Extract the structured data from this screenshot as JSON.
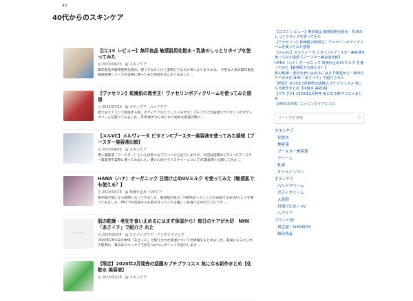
{
  "breadcrumb": "40",
  "page_title": "40代からのスキンケア",
  "posts": [
    {
      "title": "【口コミ レビュー】無印良品 敏感肌用化粧水・乳液のしっとりタイプを使ってみた",
      "date": "2020/09/25",
      "category": "スキンケア",
      "excerpt": "無印良品の敏感肌用化粧水、使ってみたいけど実際どうなのか気になりますよね。 今回は人気の無印良品 敏感肌用シリーズを実際に使ってみた感想をまとめてみました ...",
      "thumb_colors": [
        "#c9b7a3",
        "#e8e0d6",
        "#5b8fc9"
      ]
    },
    {
      "title": "【ヴァセリン】乾燥肌の救世主！ヴァセリンボディクリームを使ってみた感想",
      "date": "2020/07/20",
      "category": "ボディケア・ハンドケア",
      "excerpt": "夏でもエアコンで乾燥する肌、ボディケアはどうしていますか？プチプラで大容量なヴァセリンのボディクリームを使ってみました。30代後半から気になり始めた乾燥対策に ...",
      "thumb_colors": [
        "#b73a3a",
        "#e9d3c4",
        "#8a2424"
      ]
    },
    {
      "title": "【メルVC】メルヴィータ ビタミンCブースター美容液を使ってみた感想【ブースター美容液比較】",
      "date": "2020/04/09",
      "category": "スキンケア",
      "excerpt": "導入美容液（ブースター）といえば色々なブランドから出ていますが、今回は話題のビタミンCブースター美容液を実際に使ってみました。使い心地やテクスチャーについてVC美容液と比較してみた ...",
      "thumb_colors": [
        "#dde3ea",
        "#b7c3d2",
        "#f4f6f8"
      ]
    },
    {
      "title": "HANA（ハナ）オーガニック 日焼け止めUVミルク を使ってみた【敏感肌でも使える？】",
      "date": "2020/03/19",
      "category": "日焼け止め・UVケア",
      "excerpt": "紫外線が気になる季節になってきました。敏感肌の私が、HANAオーガニックの日焼け止めUVミルクを使ってみました。PM2.5や花粉からも肌を守ってくれる優しい日焼け止めの口コミです ...",
      "thumb_colors": [
        "#c9aebf",
        "#8d6e86",
        "#eadde4"
      ]
    },
    {
      "title": "肌の乾燥・老化を食い止めるにはまず保湿から！毎日のケアが大切　NHK「あさイチ」で紹介さ れた",
      "date": "2020/02/04",
      "category": "エイジングケア・アンチエイジング",
      "excerpt": "2020年2月4日のNHK「あさイチ」で紹介された保湿についての情報をまとめました。乾燥による小じわや肌荒れ、毎日のスキンケアで気をつけたいポイントを紹介します ...",
      "thumb_colors": [
        "#f2f2f2",
        "#f2f2f2",
        "#f2f2f2"
      ],
      "noimage_label": "NO IMAGE"
    },
    {
      "title": "【限定】2020年2月発売の話題のプチプラコスメ 気になる新作まとめ【化粧水 美容液】",
      "date": "2020/01/28",
      "category": "スキンケア",
      "excerpt": "",
      "thumb_colors": [
        "#4caf50",
        "#ffffff",
        "#e0e0e0"
      ]
    }
  ],
  "sidebar": {
    "recent_posts": [
      "【口コミ レビュー】無印良品 敏感肌用化粧水・乳液のしっとりタイプを使ってみた",
      "【ヴァセリン】乾燥肌の救世主！ヴァセリンボディクリームを使ってみた感想",
      "【メルVC】メルヴィータ ビタミンCブースター美容液を使ってみた感想【ブースター美容液比較】",
      "HANA（ハナ）オーガニック 日焼け止めUVミルク を使ってみた【敏感肌でも使える？】",
      "肌の乾燥・老化を食い止めるにはまず保湿から！毎日のケアが大切 NHK「あさイチ」で紹介された",
      "【限定】2020年2月発売の話題のプチプラコスメ 気になる新作まとめ【化粧水 美容液】",
      "【プチプラ】2020年2月発売 気になる新作コスメまとめ",
      "【MATURITE】エイジングケア口コミ"
    ],
    "search_placeholder": "サイト内を検索",
    "categories": [
      {
        "label": "スキンケア",
        "level": 0
      },
      {
        "label": "化粧水",
        "level": 1
      },
      {
        "label": "美容液",
        "level": 1
      },
      {
        "label": "ブースター美容液",
        "level": 1
      },
      {
        "label": "クリーム",
        "level": 1
      },
      {
        "label": "乳液",
        "level": 1
      },
      {
        "label": "オールインワン",
        "level": 1
      },
      {
        "label": "ボディケア",
        "level": 0
      },
      {
        "label": "ハンドクリーム",
        "level": 1
      },
      {
        "label": "ボディクリーム",
        "level": 1
      },
      {
        "label": "入浴剤",
        "level": 1
      },
      {
        "label": "日焼け止め・UV",
        "level": 1
      },
      {
        "label": "ヘアケア",
        "level": 1
      },
      {
        "label": "ブランド別",
        "level": 0
      },
      {
        "label": "資生堂・SHISEIDO",
        "level": 1
      },
      {
        "label": "無印良品",
        "level": 1
      }
    ]
  }
}
